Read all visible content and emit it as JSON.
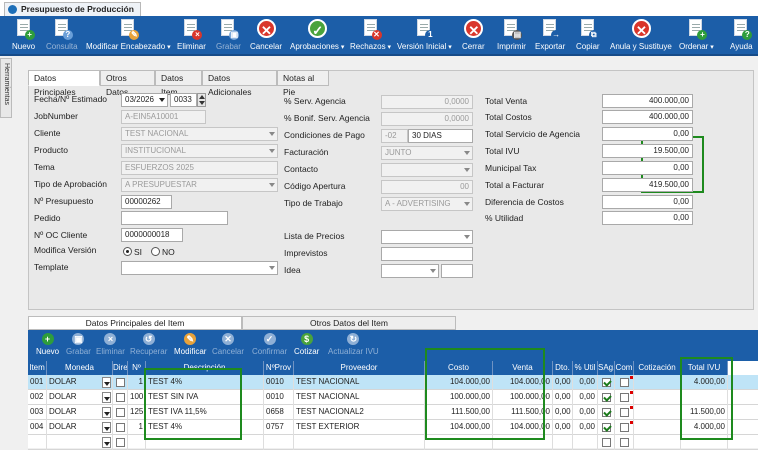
{
  "window": {
    "title": "Presupuesto de Producción"
  },
  "toolbar": [
    {
      "name": "nuevo-button",
      "label": "Nuevo",
      "icon": "new-doc-icon",
      "enabled": true,
      "color": "#2e9d3b",
      "glyph": "+"
    },
    {
      "name": "consulta-button",
      "label": "Consulta",
      "icon": "search-doc-icon",
      "enabled": false,
      "color": "#6a9fd8",
      "glyph": "?"
    },
    {
      "name": "modificar-encabezado-button",
      "label": "Modificar Encabezado",
      "icon": "edit-icon",
      "enabled": true,
      "color": "#e8a23a",
      "glyph": "✎",
      "dropdown": true
    },
    {
      "name": "eliminar-button",
      "label": "Eliminar",
      "icon": "delete-doc-icon",
      "enabled": true,
      "color": "#d9362b",
      "glyph": "×"
    },
    {
      "name": "grabar-button",
      "label": "Grabar",
      "icon": "save-icon",
      "enabled": false,
      "color": "#7aa7d9",
      "glyph": "▣"
    },
    {
      "name": "cancelar-button",
      "label": "Cancelar",
      "icon": "cancel-icon",
      "enabled": true,
      "color": "#d9362b",
      "glyph": "✕",
      "round": true
    },
    {
      "name": "aprobaciones-button",
      "label": "Aprobaciones",
      "icon": "approve-icon",
      "enabled": true,
      "color": "#4aa33c",
      "glyph": "✓",
      "round": true,
      "dropdown": true
    },
    {
      "name": "rechazos-button",
      "label": "Rechazos",
      "icon": "reject-icon",
      "enabled": true,
      "color": "#d9362b",
      "glyph": "✕",
      "dropdown": true
    },
    {
      "name": "version-inicial-button",
      "label": "Versión Inicial",
      "icon": "version-doc-icon",
      "enabled": true,
      "color": "#1c5ea8",
      "glyph": "1",
      "dropdown": true
    },
    {
      "name": "cerrar-button",
      "label": "Cerrar",
      "icon": "close-icon",
      "enabled": true,
      "color": "#d9362b",
      "glyph": "✕",
      "round": true
    },
    {
      "name": "imprimir-button",
      "label": "Imprimir",
      "icon": "printer-icon",
      "enabled": true,
      "color": "#555",
      "glyph": "▤"
    },
    {
      "name": "exportar-button",
      "label": "Exportar",
      "icon": "export-icon",
      "enabled": true,
      "color": "#1c5ea8",
      "glyph": "→"
    },
    {
      "name": "copiar-button",
      "label": "Copiar",
      "icon": "copy-icon",
      "enabled": true,
      "color": "#1c5ea8",
      "glyph": "⧉"
    },
    {
      "name": "anula-sustituye-button",
      "label": "Anula y Sustituye",
      "icon": "void-icon",
      "enabled": true,
      "color": "#d9362b",
      "glyph": "✕",
      "round": true
    },
    {
      "name": "ordenar-button",
      "label": "Ordenar",
      "icon": "order-doc-icon",
      "enabled": true,
      "color": "#2e9d3b",
      "glyph": "+",
      "dropdown": true
    },
    {
      "name": "ayuda-button",
      "label": "Ayuda",
      "icon": "help-book-icon",
      "enabled": true,
      "color": "#2e9d3b",
      "glyph": "?"
    }
  ],
  "sidebar": {
    "label": "Herramientas"
  },
  "tabs": [
    "Datos Principales",
    "Otros Datos",
    "Datos Item",
    "Datos Adicionales",
    "Notas al Pie"
  ],
  "form": {
    "fecha_label": "Fecha/Nº Estimado",
    "fecha_value": "03/2026",
    "estimado_value": "0033",
    "jobnumber_label": "JobNumber",
    "jobnumber_value": "A-EIN5A10001",
    "cliente_label": "Cliente",
    "cliente_value": "TEST NACIONAL",
    "producto_label": "Producto",
    "producto_value": "INSTITUCIONAL",
    "tema_label": "Tema",
    "tema_value": "ESFUERZOS 2025",
    "tipo_aprob_label": "Tipo de Aprobación",
    "tipo_aprob_value": "A PRESUPUESTAR",
    "npres_label": "Nº Presupuesto",
    "npres_value": "00000262",
    "pedido_label": "Pedido",
    "pedido_value": "",
    "noc_label": "Nº OC Cliente",
    "noc_value": "0000000018",
    "modver_label": "Modifica Versión",
    "si_label": "SI",
    "no_label": "NO",
    "template_label": "Template",
    "template_value": ""
  },
  "mid": {
    "serv_agencia_label": "% Serv. Agencia",
    "serv_agencia_value": "0,0000",
    "bonif_label": "% Bonif. Serv. Agencia",
    "bonif_value": "0,0000",
    "cond_pago_label": "Condiciones de Pago",
    "cond_pago_code": "-02",
    "cond_pago_value": "30 DIAS",
    "facturacion_label": "Facturación",
    "facturacion_value": "JUNTO",
    "contacto_label": "Contacto",
    "contacto_value": "",
    "codigo_apertura_label": "Código Apertura",
    "codigo_apertura_value": "00",
    "tipo_trabajo_label": "Tipo de Trabajo",
    "tipo_trabajo_value": "A - ADVERTISING",
    "lista_precios_label": "Lista de Precios",
    "imprevistos_label": "Imprevistos",
    "idea_label": "Idea"
  },
  "totals": [
    {
      "label": "Total Venta",
      "value": "400.000,00"
    },
    {
      "label": "Total Costos",
      "value": "400.000,00"
    },
    {
      "label": "Total Servicio de Agencia",
      "value": "0,00"
    },
    {
      "label": "Total IVU",
      "value": "19.500,00"
    },
    {
      "label": "Municipal Tax",
      "value": "0,00"
    },
    {
      "label": "Total a Facturar",
      "value": "419.500,00"
    },
    {
      "label": "Diferencia de Costos",
      "value": "0,00"
    },
    {
      "label": "% Utilidad",
      "value": "0,00"
    }
  ],
  "lower_tabs": [
    "Datos Principales del Item",
    "Otros Datos del Item"
  ],
  "item_toolbar": [
    {
      "name": "item-nuevo-button",
      "label": "Nuevo",
      "icon": "item-new-icon",
      "enabled": true,
      "color": "#2e9d3b",
      "glyph": "+"
    },
    {
      "name": "item-grabar-button",
      "label": "Grabar",
      "icon": "item-save-icon",
      "enabled": false,
      "color": "#8fb0d6",
      "glyph": "▣"
    },
    {
      "name": "item-eliminar-button",
      "label": "Eliminar",
      "icon": "item-delete-icon",
      "enabled": false,
      "color": "#8fb0d6",
      "glyph": "×"
    },
    {
      "name": "item-recuperar-button",
      "label": "Recuperar",
      "icon": "item-recover-icon",
      "enabled": false,
      "color": "#8fb0d6",
      "glyph": "↺"
    },
    {
      "name": "item-modificar-button",
      "label": "Modificar",
      "icon": "item-edit-icon",
      "enabled": true,
      "color": "#e8a23a",
      "glyph": "✎"
    },
    {
      "name": "item-cancelar-button",
      "label": "Cancelar",
      "icon": "item-cancel-icon",
      "enabled": false,
      "color": "#8fb0d6",
      "glyph": "✕"
    },
    {
      "name": "item-confirmar-button",
      "label": "Confirmar",
      "icon": "item-confirm-icon",
      "enabled": false,
      "color": "#8fb0d6",
      "glyph": "✓"
    },
    {
      "name": "item-cotizar-button",
      "label": "Cotizar",
      "icon": "item-quote-icon",
      "enabled": true,
      "color": "#4aa33c",
      "glyph": "$"
    },
    {
      "name": "item-actualizar-ivu-button",
      "label": "Actualizar IVU",
      "icon": "item-refresh-icon",
      "enabled": false,
      "color": "#8fb0d6",
      "glyph": "↻"
    }
  ],
  "grid": {
    "headers": [
      "Item",
      "Moneda",
      "Dire",
      "Nº",
      "Descripción",
      "NºProv",
      "Proveedor",
      "Costo",
      "Venta",
      "Dto.",
      "% Util",
      "SAg.",
      "Com",
      "Cotización",
      "Total IVU"
    ],
    "rows": [
      {
        "item": "001",
        "moneda": "DOLAR",
        "dire": false,
        "n": "1",
        "desc": "TEST 4%",
        "nprov": "0010",
        "prov": "TEST NACIONAL",
        "costo": "104.000,00",
        "venta": "104.000,00",
        "dto": "0,00",
        "util": "0,00",
        "sag": true,
        "com": false,
        "cot": "",
        "ivu": "4.000,00"
      },
      {
        "item": "002",
        "moneda": "DOLAR",
        "dire": false,
        "n": "100",
        "desc": "TEST SIN IVA",
        "nprov": "0010",
        "prov": "TEST NACIONAL",
        "costo": "100.000,00",
        "venta": "100.000,00",
        "dto": "0,00",
        "util": "0,00",
        "sag": true,
        "com": false,
        "cot": "",
        "ivu": ""
      },
      {
        "item": "003",
        "moneda": "DOLAR",
        "dire": false,
        "n": "125",
        "desc": "TEST IVA 11,5%",
        "nprov": "0658",
        "prov": "TEST NACIONAL2",
        "costo": "111.500,00",
        "venta": "111.500,00",
        "dto": "0,00",
        "util": "0,00",
        "sag": true,
        "com": false,
        "cot": "",
        "ivu": "11.500,00"
      },
      {
        "item": "004",
        "moneda": "DOLAR",
        "dire": false,
        "n": "1",
        "desc": "TEST 4%",
        "nprov": "0757",
        "prov": "TEST EXTERIOR",
        "costo": "104.000,00",
        "venta": "104.000,00",
        "dto": "0,00",
        "util": "0,00",
        "sag": true,
        "com": false,
        "cot": "",
        "ivu": "4.000,00"
      },
      {
        "item": "",
        "moneda": "",
        "dire": false,
        "n": "",
        "desc": "",
        "nprov": "",
        "prov": "",
        "costo": "",
        "venta": "",
        "dto": "",
        "util": "",
        "sag": false,
        "com": false,
        "cot": "",
        "ivu": ""
      }
    ]
  }
}
